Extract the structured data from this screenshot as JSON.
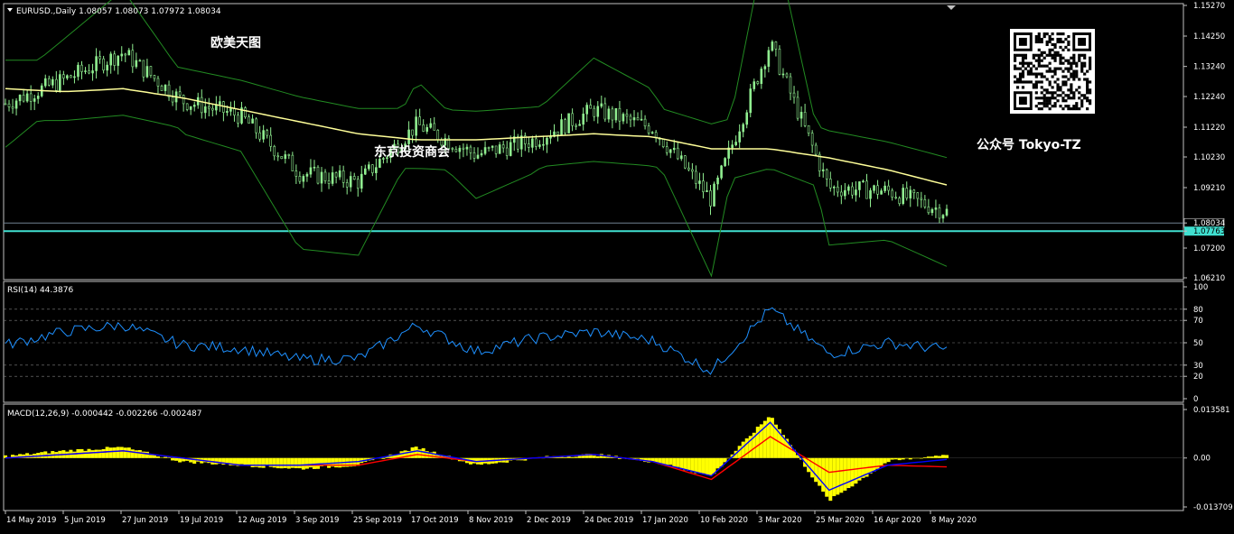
{
  "symbol_header": "EURUSD.,Daily  1.08057 1.08073 1.07972 1.08034",
  "watermarks": {
    "title_cn": "欧美天图",
    "center_cn": "东京投资商会",
    "wechat": "公众号 Tokyo-TZ"
  },
  "colors": {
    "background": "#000000",
    "frame": "#c0c0c0",
    "bull_candle": "#90ee90",
    "bear_candle": "#000000",
    "bollinger": "#228b22",
    "moving_average": "#ffff99",
    "support_line": "#40e0d0",
    "rsi_line": "#1e90ff",
    "macd_histogram": "#ffff00",
    "macd_line": "#0000ff",
    "signal_line": "#ff0000",
    "price_label_current": "#ffffff",
    "price_label_support": "#40e0d0"
  },
  "price_panel": {
    "y_ticks": [
      "1.15270",
      "1.14250",
      "1.13240",
      "1.12240",
      "1.11220",
      "1.10230",
      "1.09210",
      "1.08034",
      "1.07763",
      "1.07200",
      "1.06210"
    ],
    "current_price": "1.08034",
    "support_price": "1.07763"
  },
  "rsi_panel": {
    "label": "RSI(14) 44.3876",
    "y_ticks": [
      "100",
      "80",
      "70",
      "50",
      "30",
      "20",
      "0"
    ]
  },
  "macd_panel": {
    "label": "MACD(12,26,9) -0.000442 -0.002266 -0.002487",
    "y_ticks": [
      "0.013581",
      "0.00",
      "-0.013709"
    ]
  },
  "x_axis": {
    "labels": [
      "14 May 2019",
      "5 Jun 2019",
      "27 Jun 2019",
      "19 Jul 2019",
      "12 Aug 2019",
      "3 Sep 2019",
      "25 Sep 2019",
      "17 Oct 2019",
      "8 Nov 2019",
      "2 Dec 2019",
      "24 Dec 2019",
      "17 Jan 2020",
      "10 Feb 2020",
      "3 Mar 2020",
      "25 Mar 2020",
      "16 Apr 2020",
      "8 May 2020"
    ]
  },
  "chart_data": {
    "type": "line",
    "title": "EURUSD.,Daily",
    "x": [
      "14 May 2019",
      "5 Jun 2019",
      "27 Jun 2019",
      "19 Jul 2019",
      "12 Aug 2019",
      "3 Sep 2019",
      "25 Sep 2019",
      "17 Oct 2019",
      "8 Nov 2019",
      "2 Dec 2019",
      "24 Dec 2019",
      "17 Jan 2020",
      "10 Feb 2020",
      "3 Mar 2020",
      "25 Mar 2020",
      "16 Apr 2020",
      "8 May 2020"
    ],
    "ylim": [
      1.0621,
      1.1527
    ],
    "series": [
      {
        "name": "EURUSD close (approx.)",
        "values": [
          1.12,
          1.128,
          1.137,
          1.121,
          1.116,
          1.097,
          1.094,
          1.113,
          1.103,
          1.108,
          1.118,
          1.112,
          1.088,
          1.14,
          1.092,
          1.091,
          1.084
        ]
      },
      {
        "name": "Moving average (approx.)",
        "values": [
          1.125,
          1.124,
          1.125,
          1.122,
          1.118,
          1.114,
          1.11,
          1.108,
          1.108,
          1.109,
          1.11,
          1.109,
          1.105,
          1.105,
          1.102,
          1.098,
          1.093
        ]
      }
    ],
    "rsi": {
      "values": [
        48,
        60,
        66,
        48,
        45,
        35,
        36,
        66,
        42,
        54,
        60,
        52,
        25,
        80,
        40,
        50,
        44
      ],
      "ylim": [
        0,
        100
      ]
    },
    "macd": {
      "histogram": [
        0.0005,
        0.002,
        0.003,
        -0.001,
        -0.002,
        -0.003,
        -0.002,
        0.003,
        -0.002,
        0.0,
        0.001,
        -0.001,
        -0.005,
        0.012,
        -0.012,
        -0.001,
        0.001
      ],
      "macd": [
        0.0,
        0.001,
        0.002,
        0.0,
        -0.002,
        -0.002,
        -0.001,
        0.002,
        -0.001,
        0.0,
        0.001,
        -0.001,
        -0.005,
        0.01,
        -0.009,
        -0.002,
        -0.0004
      ],
      "signal": [
        0.0,
        0.001,
        0.002,
        0.0,
        -0.002,
        -0.002,
        -0.002,
        0.001,
        -0.001,
        0.0,
        0.001,
        -0.001,
        -0.006,
        0.006,
        -0.004,
        -0.002,
        -0.0025
      ],
      "ylim": [
        -0.013709,
        0.013581
      ]
    }
  }
}
